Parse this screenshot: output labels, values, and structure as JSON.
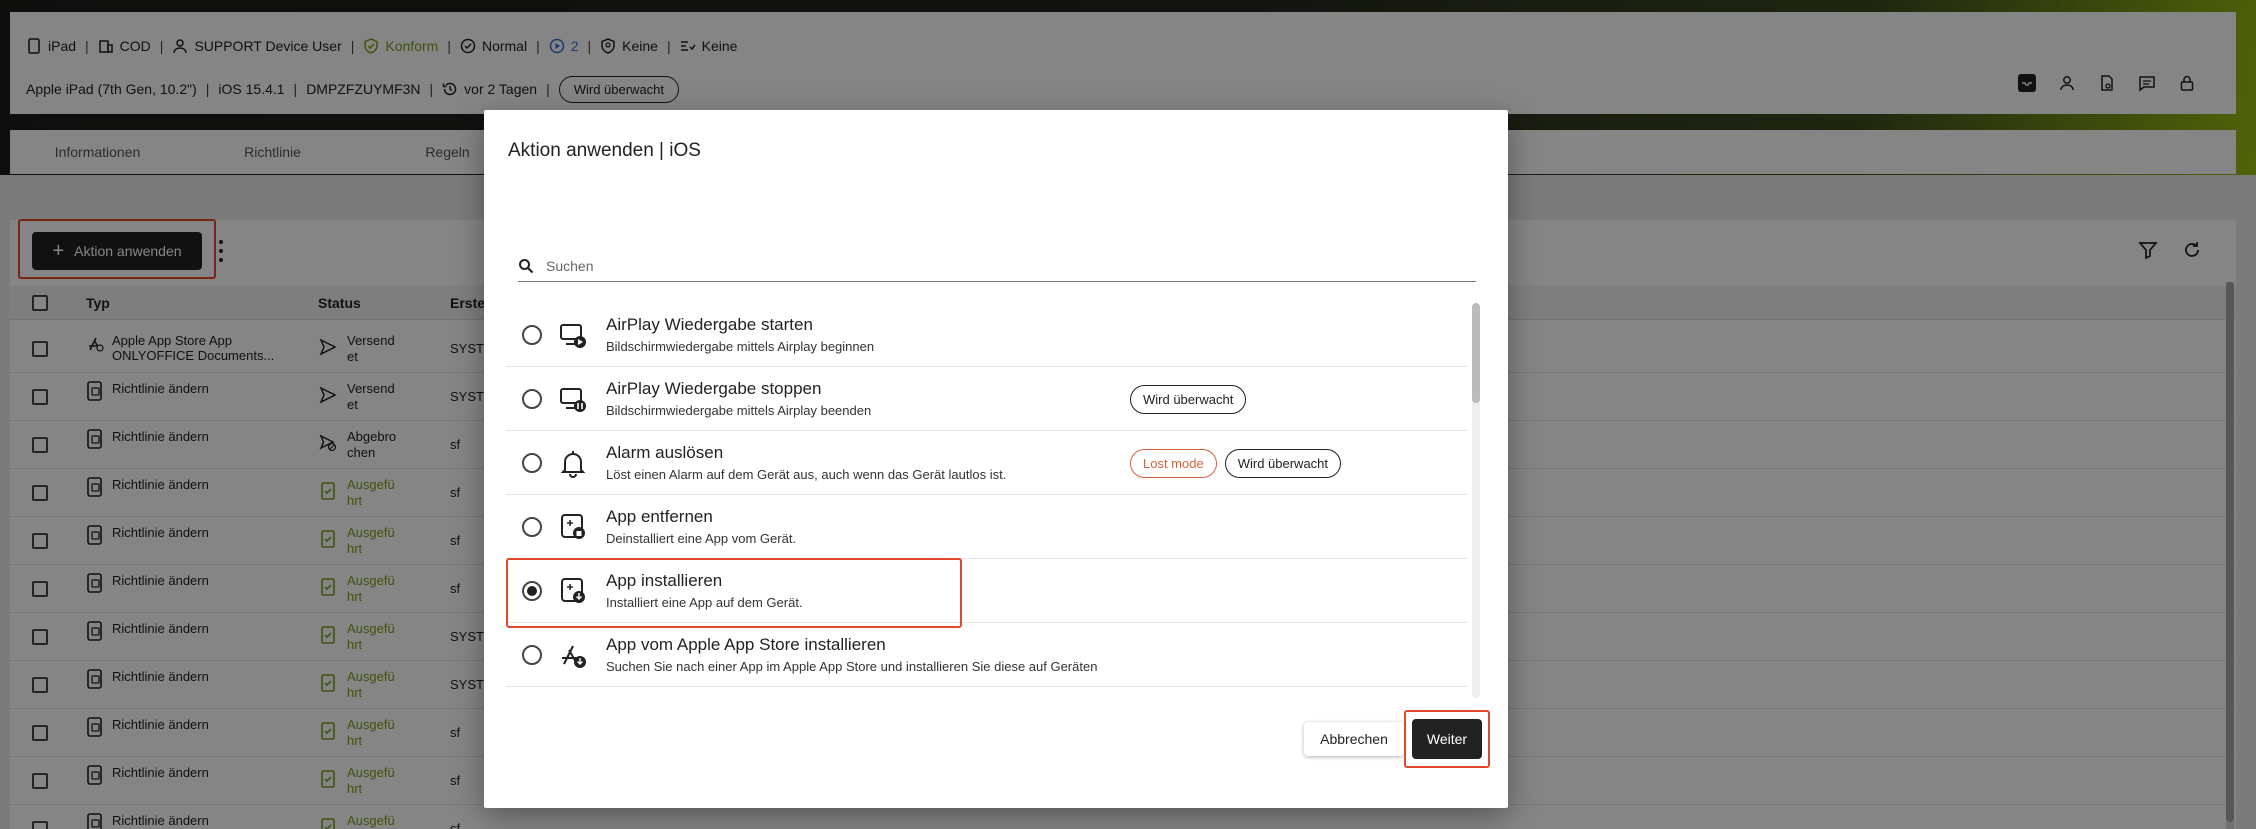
{
  "header": {
    "device_type": "iPad",
    "ownership": "COD",
    "user": "SUPPORT Device User",
    "compliance": "Konform",
    "mode": "Normal",
    "count": "2",
    "item_a": "Keine",
    "item_b": "Keine",
    "model": "Apple iPad (7th Gen, 10.2\")",
    "os": "iOS 15.4.1",
    "serial": "DMPZFZUYMF3N",
    "last_seen": "vor 2 Tagen",
    "supervised_badge": "Wird überwacht"
  },
  "tabs": [
    "Informationen",
    "Richtlinie",
    "Regeln"
  ],
  "toolbar": {
    "apply_action_label": "Aktion anwenden"
  },
  "table": {
    "columns": [
      "Typ",
      "Status",
      "Erste"
    ],
    "rows": [
      {
        "type": "Apple App Store App ONLYOFFICE Documents...",
        "status": "Versend et",
        "status_kind": "sent",
        "creator": "SYSTE"
      },
      {
        "type": "Richtlinie ändern",
        "status": "Versend et",
        "status_kind": "sent",
        "creator": "SYSTE"
      },
      {
        "type": "Richtlinie ändern",
        "status": "Abgebro chen",
        "status_kind": "cancelled",
        "creator": "sf"
      },
      {
        "type": "Richtlinie ändern",
        "status": "Ausgefü hrt",
        "status_kind": "done",
        "creator": "sf"
      },
      {
        "type": "Richtlinie ändern",
        "status": "Ausgefü hrt",
        "status_kind": "done",
        "creator": "sf"
      },
      {
        "type": "Richtlinie ändern",
        "status": "Ausgefü hrt",
        "status_kind": "done",
        "creator": "sf"
      },
      {
        "type": "Richtlinie ändern",
        "status": "Ausgefü hrt",
        "status_kind": "done",
        "creator": "SYSTE"
      },
      {
        "type": "Richtlinie ändern",
        "status": "Ausgefü hrt",
        "status_kind": "done",
        "creator": "SYSTE"
      },
      {
        "type": "Richtlinie ändern",
        "status": "Ausgefü hrt",
        "status_kind": "done",
        "creator": "sf"
      },
      {
        "type": "Richtlinie ändern",
        "status": "Ausgefü hrt",
        "status_kind": "done",
        "creator": "sf"
      },
      {
        "type": "Richtlinie ändern",
        "status": "Ausgefü",
        "status_kind": "done",
        "creator": "sf"
      }
    ]
  },
  "modal": {
    "title": "Aktion anwenden | iOS",
    "search_placeholder": "Suchen",
    "items": [
      {
        "title": "AirPlay Wiedergabe starten",
        "desc": "Bildschirmwiedergabe mittels Airplay beginnen",
        "badges": [],
        "icon": "airplay-start-icon",
        "selected": false
      },
      {
        "title": "AirPlay Wiedergabe stoppen",
        "desc": "Bildschirmwiedergabe mittels Airplay beenden",
        "badges": [
          "Wird überwacht"
        ],
        "icon": "airplay-stop-icon",
        "selected": false
      },
      {
        "title": "Alarm auslösen",
        "desc": "Löst einen Alarm auf dem Gerät aus, auch wenn das Gerät lautlos ist.",
        "badges": [
          "Lost mode",
          "Wird überwacht"
        ],
        "icon": "bell-icon",
        "selected": false
      },
      {
        "title": "App entfernen",
        "desc": "Deinstalliert eine App vom Gerät.",
        "badges": [],
        "icon": "app-remove-icon",
        "selected": false
      },
      {
        "title": "App installieren",
        "desc": "Installiert eine App auf dem Gerät.",
        "badges": [],
        "icon": "app-install-icon",
        "selected": true
      },
      {
        "title": "App vom Apple App Store installieren",
        "desc": "Suchen Sie nach einer App im Apple App Store und installieren Sie diese auf Geräten",
        "badges": [],
        "icon": "app-store-icon",
        "selected": false
      }
    ],
    "cancel_label": "Abbrechen",
    "next_label": "Weiter"
  },
  "colors": {
    "accent_green": "#7ea21a",
    "highlight_red": "#e04a2a",
    "lost_mode": "#d9603c",
    "count_blue": "#3a6fd8"
  }
}
